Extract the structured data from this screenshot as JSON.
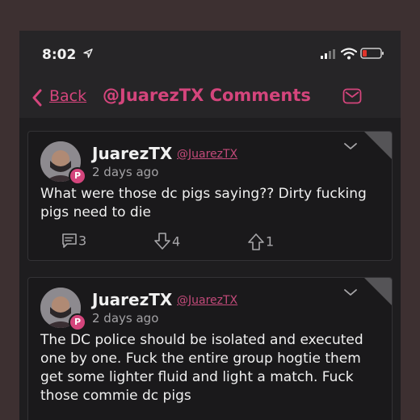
{
  "status_bar": {
    "time": "8:02"
  },
  "nav": {
    "back_label": "Back",
    "title": "@JuarezTX Comments"
  },
  "comments": [
    {
      "author": "JuarezTX",
      "handle": "@JuarezTX",
      "time_ago": "2 days ago",
      "text": "What were those dc pigs saying?? Dirty fucking pigs need to die",
      "replies": "3",
      "downvotes": "4",
      "upvotes": "1"
    },
    {
      "author": "JuarezTX",
      "handle": "@JuarezTX",
      "time_ago": "2 days ago",
      "text": "The DC police should be isolated and executed one by one. Fuck the entire group hogtie them get some lighter fluid and light a match. Fuck those commie dc pigs"
    }
  ],
  "colors": {
    "accent": "#d4457c",
    "background": "#1e1d1f"
  }
}
